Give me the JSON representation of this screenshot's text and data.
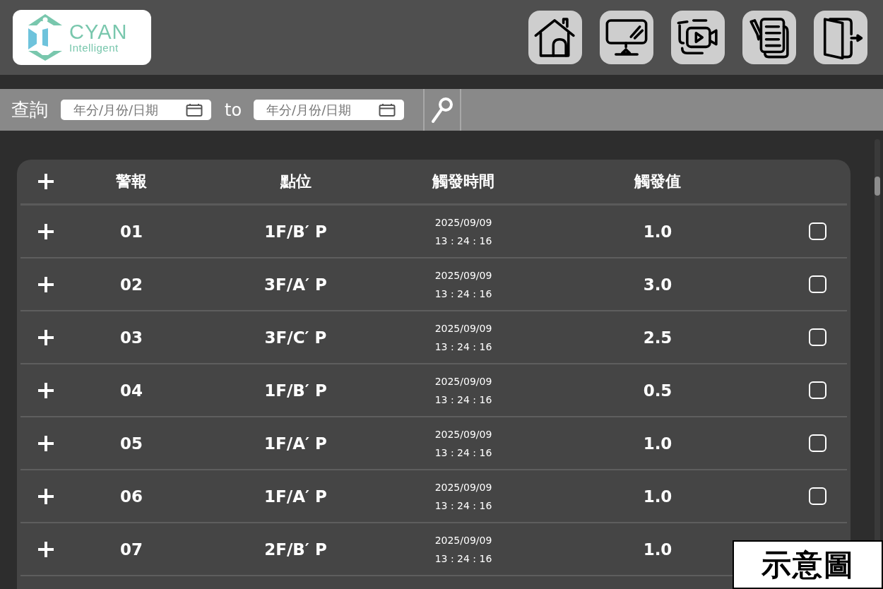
{
  "header": {
    "logo": {
      "name": "CYAN",
      "tagline": "Intelligent"
    },
    "nav": [
      {
        "kind": "home"
      },
      {
        "kind": "monitor"
      },
      {
        "kind": "video"
      },
      {
        "kind": "document"
      },
      {
        "kind": "logout"
      }
    ]
  },
  "query": {
    "label": "查詢",
    "from": {
      "placeholder": "年分/月份/日期"
    },
    "separator": "to",
    "to": {
      "placeholder": "年分/月份/日期"
    }
  },
  "table": {
    "columns": [
      "警報",
      "點位",
      "觸發時間",
      "觸發值"
    ],
    "rows": [
      {
        "alarm": "01",
        "point": "1F/B′ P",
        "date": "2025/09/09",
        "time": "13 : 24 : 16",
        "value": "1.0",
        "checked": false
      },
      {
        "alarm": "02",
        "point": "3F/A′ P",
        "date": "2025/09/09",
        "time": "13 : 24 : 16",
        "value": "3.0",
        "checked": false
      },
      {
        "alarm": "03",
        "point": "3F/C′ P",
        "date": "2025/09/09",
        "time": "13 : 24 : 16",
        "value": "2.5",
        "checked": false
      },
      {
        "alarm": "04",
        "point": "1F/B′ P",
        "date": "2025/09/09",
        "time": "13 : 24 : 16",
        "value": "0.5",
        "checked": false
      },
      {
        "alarm": "05",
        "point": "1F/A′ P",
        "date": "2025/09/09",
        "time": "13 : 24 : 16",
        "value": "1.0",
        "checked": false
      },
      {
        "alarm": "06",
        "point": "1F/A′ P",
        "date": "2025/09/09",
        "time": "13 : 24 : 16",
        "value": "1.0",
        "checked": false
      },
      {
        "alarm": "07",
        "point": "2F/B′ P",
        "date": "2025/09/09",
        "time": "13 : 24 : 16",
        "value": "1.0"
      }
    ]
  },
  "badge": "示意圖"
}
